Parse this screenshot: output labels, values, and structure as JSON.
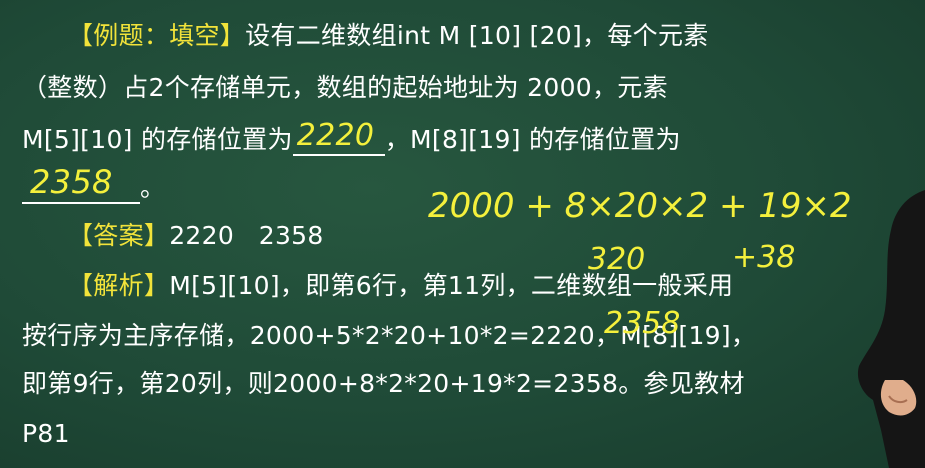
{
  "question": {
    "tag": "【例题：填空】",
    "line1": "设有二维数组int M [10] [20]，每个元素",
    "line2": "（整数）占2个存储单元，数组的起始地址为 2000，元素",
    "line3_a": "M[5][10] 的存储位置为",
    "blank1": "2220",
    "line3_b": "，M[8][19] 的存储位置为",
    "blank2": "2358",
    "line4_end": "。"
  },
  "answer": {
    "tag": "【答案】",
    "text": "2220   2358"
  },
  "analysis": {
    "tag": "【解析】",
    "line1": "M[5][10]，即第6行，第11列，二维数组一般采用",
    "line2": "按行序为主序存储，2000+5*2*20+10*2=2220，M[8][19]，",
    "line3": "即第9行，第20列，则2000+8*2*20+19*2=2358。参见教材",
    "line4": "P81"
  },
  "handwriting": {
    "formula": "2000 + 8×20×2 + 19×2",
    "sub1": "320",
    "sub2": "+38",
    "sum": "2358"
  },
  "colors": {
    "board": "#1f4a37",
    "tag": "#f2e33a",
    "text": "#ffffff",
    "chalk": "#f4f03c"
  }
}
